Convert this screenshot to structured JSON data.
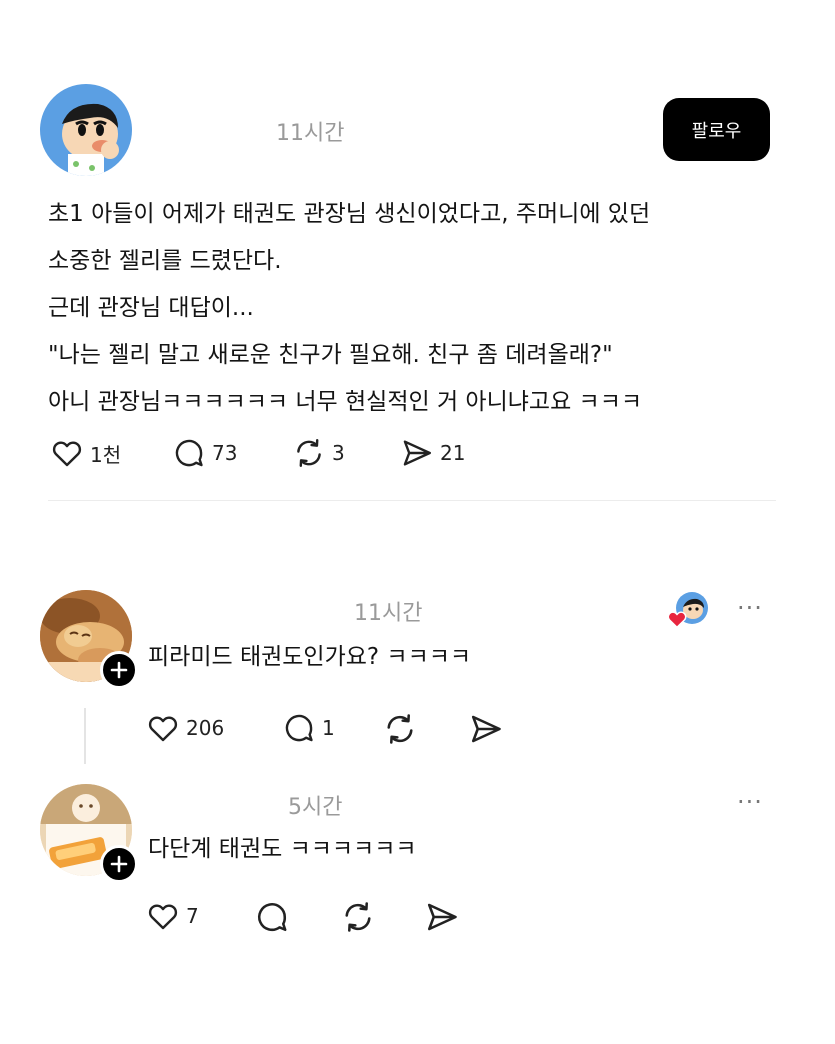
{
  "post": {
    "time": "11시간",
    "follow_label": "팔로우",
    "lines": [
      "초1 아들이 어제가 태권도 관장님 생신이었다고, 주머니에 있던",
      "소중한 젤리를 드렸단다.",
      "근데 관장님 대답이...",
      "\"나는 젤리 말고 새로운 친구가 필요해. 친구 좀 데려올래?\"",
      "아니 관장님ㅋㅋㅋㅋㅋㅋ 너무 현실적인 거 아니냐고요 ㅋㅋㅋ"
    ],
    "likes": "1천",
    "comments": "73",
    "reposts": "3",
    "shares": "21"
  },
  "replies": [
    {
      "time": "11시간",
      "text": "피라미드 태권도인가요? ㅋㅋㅋㅋ",
      "likes": "206",
      "comments": "1",
      "more": "···"
    },
    {
      "time": "5시간",
      "text": "다단계 태권도 ㅋㅋㅋㅋㅋㅋ",
      "likes": "7",
      "more": "···"
    }
  ],
  "colors": {
    "accent_heart": "#e8253f",
    "button_bg": "#000000",
    "avatar_blue": "#5b9fe3"
  }
}
